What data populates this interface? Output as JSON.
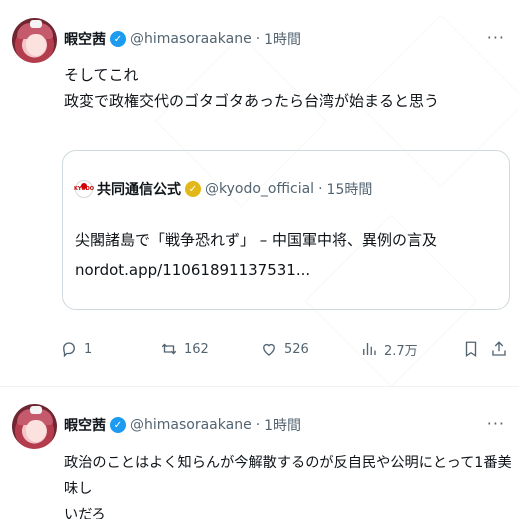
{
  "tweets": [
    {
      "author_name": "暇空茜",
      "handle": "@himasoraakane",
      "dot": "·",
      "time": "1時間",
      "text_lines": [
        "そしてこれ",
        "政変で政権交代のゴタゴタあったら台湾が始まると思う"
      ],
      "quote": {
        "author_name": "共同通信公式",
        "handle": "@kyodo_official",
        "dot": "·",
        "time": "15時間",
        "title": "尖閣諸島で「戦争恐れず」 – 中国軍中将、異例の言及",
        "link": "nordot.app/11061891137531..."
      },
      "actions": {
        "replies": "1",
        "retweets": "162",
        "likes": "526",
        "views": "2.7万"
      }
    },
    {
      "author_name": "暇空茜",
      "handle": "@himasoraakane",
      "dot": "·",
      "time": "1時間",
      "text_lines": [
        "政治のことはよく知らんが今解散するのが反自民や公明にとって1番美味し",
        "いだろ"
      ]
    }
  ],
  "colors": {
    "text": "#0f1419",
    "muted": "#536471",
    "verified_blue": "#1d9bf0",
    "verified_gold": "#e2b719",
    "border": "#cfd9de"
  },
  "icons": {
    "more": "more-dots-icon",
    "verified": "verified-badge-icon",
    "reply": "reply-icon",
    "retweet": "retweet-icon",
    "like": "heart-icon",
    "views": "views-chart-icon",
    "bookmark": "bookmark-icon",
    "share": "share-icon"
  }
}
